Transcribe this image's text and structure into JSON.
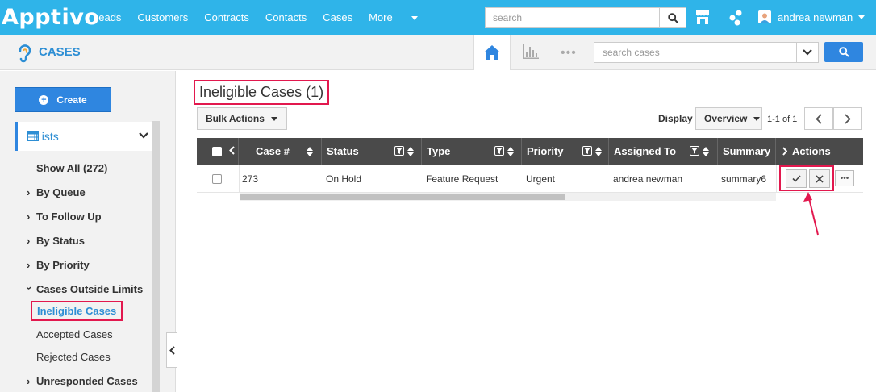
{
  "topbar": {
    "logo": "Apptivo",
    "nav": [
      "Leads",
      "Customers",
      "Contracts",
      "Contacts",
      "Cases"
    ],
    "more": "More",
    "search_placeholder": "search",
    "user_name": "andrea newman"
  },
  "appbar": {
    "title": "CASES",
    "dots": "•••",
    "search_placeholder": "search cases"
  },
  "sidebar": {
    "create": "Create",
    "lists": "Lists",
    "items": {
      "show_all": "Show All (272)",
      "by_queue": "By Queue",
      "to_follow_up": "To Follow Up",
      "by_status": "By Status",
      "by_priority": "By Priority",
      "outside_limits": "Cases Outside Limits",
      "ineligible": "Ineligible Cases",
      "accepted": "Accepted Cases",
      "rejected": "Rejected Cases",
      "unresponded": "Unresponded Cases"
    }
  },
  "main": {
    "title": "Ineligible Cases (1)",
    "bulk_actions": "Bulk Actions",
    "display_label": "Display",
    "display_value": "Overview",
    "pager": "1-1 of 1",
    "columns": {
      "case_no": "Case #",
      "status": "Status",
      "type": "Type",
      "priority": "Priority",
      "assigned_to": "Assigned To",
      "summary": "Summary",
      "actions": "Actions"
    },
    "row": {
      "case_no": "273",
      "status": "On Hold",
      "type": "Feature Request",
      "priority": "Urgent",
      "assigned_to": "andrea newman",
      "summary": "summary6"
    },
    "more_label": "•••"
  },
  "colors": {
    "topbar": "#2fb4e9",
    "accent": "#2f86e0",
    "highlight": "#e2184e",
    "header": "#4a4a4a"
  }
}
